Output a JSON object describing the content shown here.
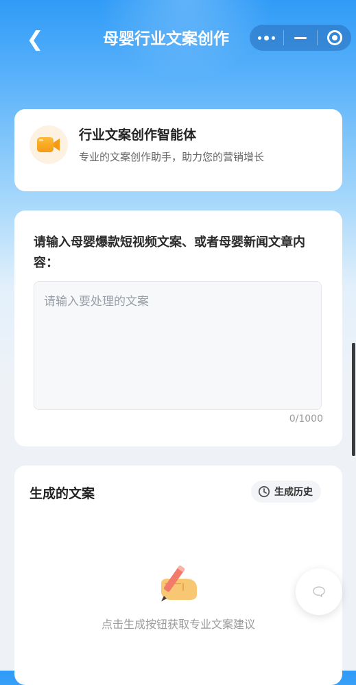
{
  "header": {
    "back_icon": "chevron-left-icon",
    "back_glyph": "❮",
    "title": "母婴行业文案创作",
    "capsule": {
      "more_icon": "more-dots-icon",
      "minimize_icon": "minimize-icon",
      "close_icon": "target-close-icon"
    }
  },
  "intro_card": {
    "icon": "video-camera-icon",
    "icon_color": "#f7a21b",
    "icon_bg": "#fdf1e2",
    "title": "行业文案创作智能体",
    "subtitle": "专业的文案创作助手，助力您的营销增长"
  },
  "input_card": {
    "prompt": "请输入母婴爆款短视频文案、或者母婴新闻文章内容：",
    "textarea": {
      "value": "",
      "placeholder": "请输入要处理的文案"
    },
    "counter": "0/1000"
  },
  "result_card": {
    "title": "生成的文案",
    "history_button": {
      "icon": "clock-icon",
      "label": "生成历史"
    },
    "empty_icon": "writing-hand-icon",
    "empty_text": "点击生成按钮获取专业文案建议"
  },
  "floating_button": {
    "icon": "chat-bubble-icon"
  },
  "colors": {
    "header_blue": "#2f9bf7",
    "text_dark": "#222222",
    "text_muted": "#9a9a9a",
    "accent_orange": "#f7a21b"
  }
}
